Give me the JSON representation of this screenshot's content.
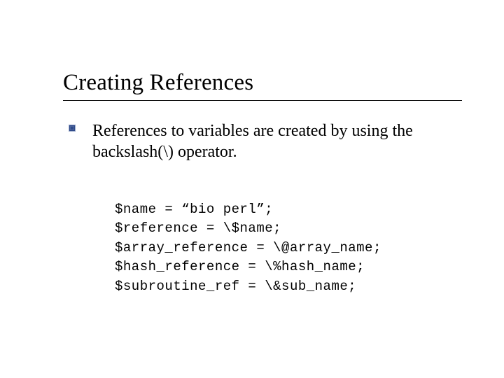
{
  "slide": {
    "title": "Creating References",
    "bullet": {
      "text": "References to variables are created by using the backslash(\\) operator."
    },
    "code": {
      "lines": [
        "$name = “bio perl”;",
        "$reference = \\$name;",
        "$array_reference = \\@array_name;",
        "$hash_reference = \\%hash_name;",
        "$subroutine_ref = \\&sub_name;"
      ]
    }
  }
}
